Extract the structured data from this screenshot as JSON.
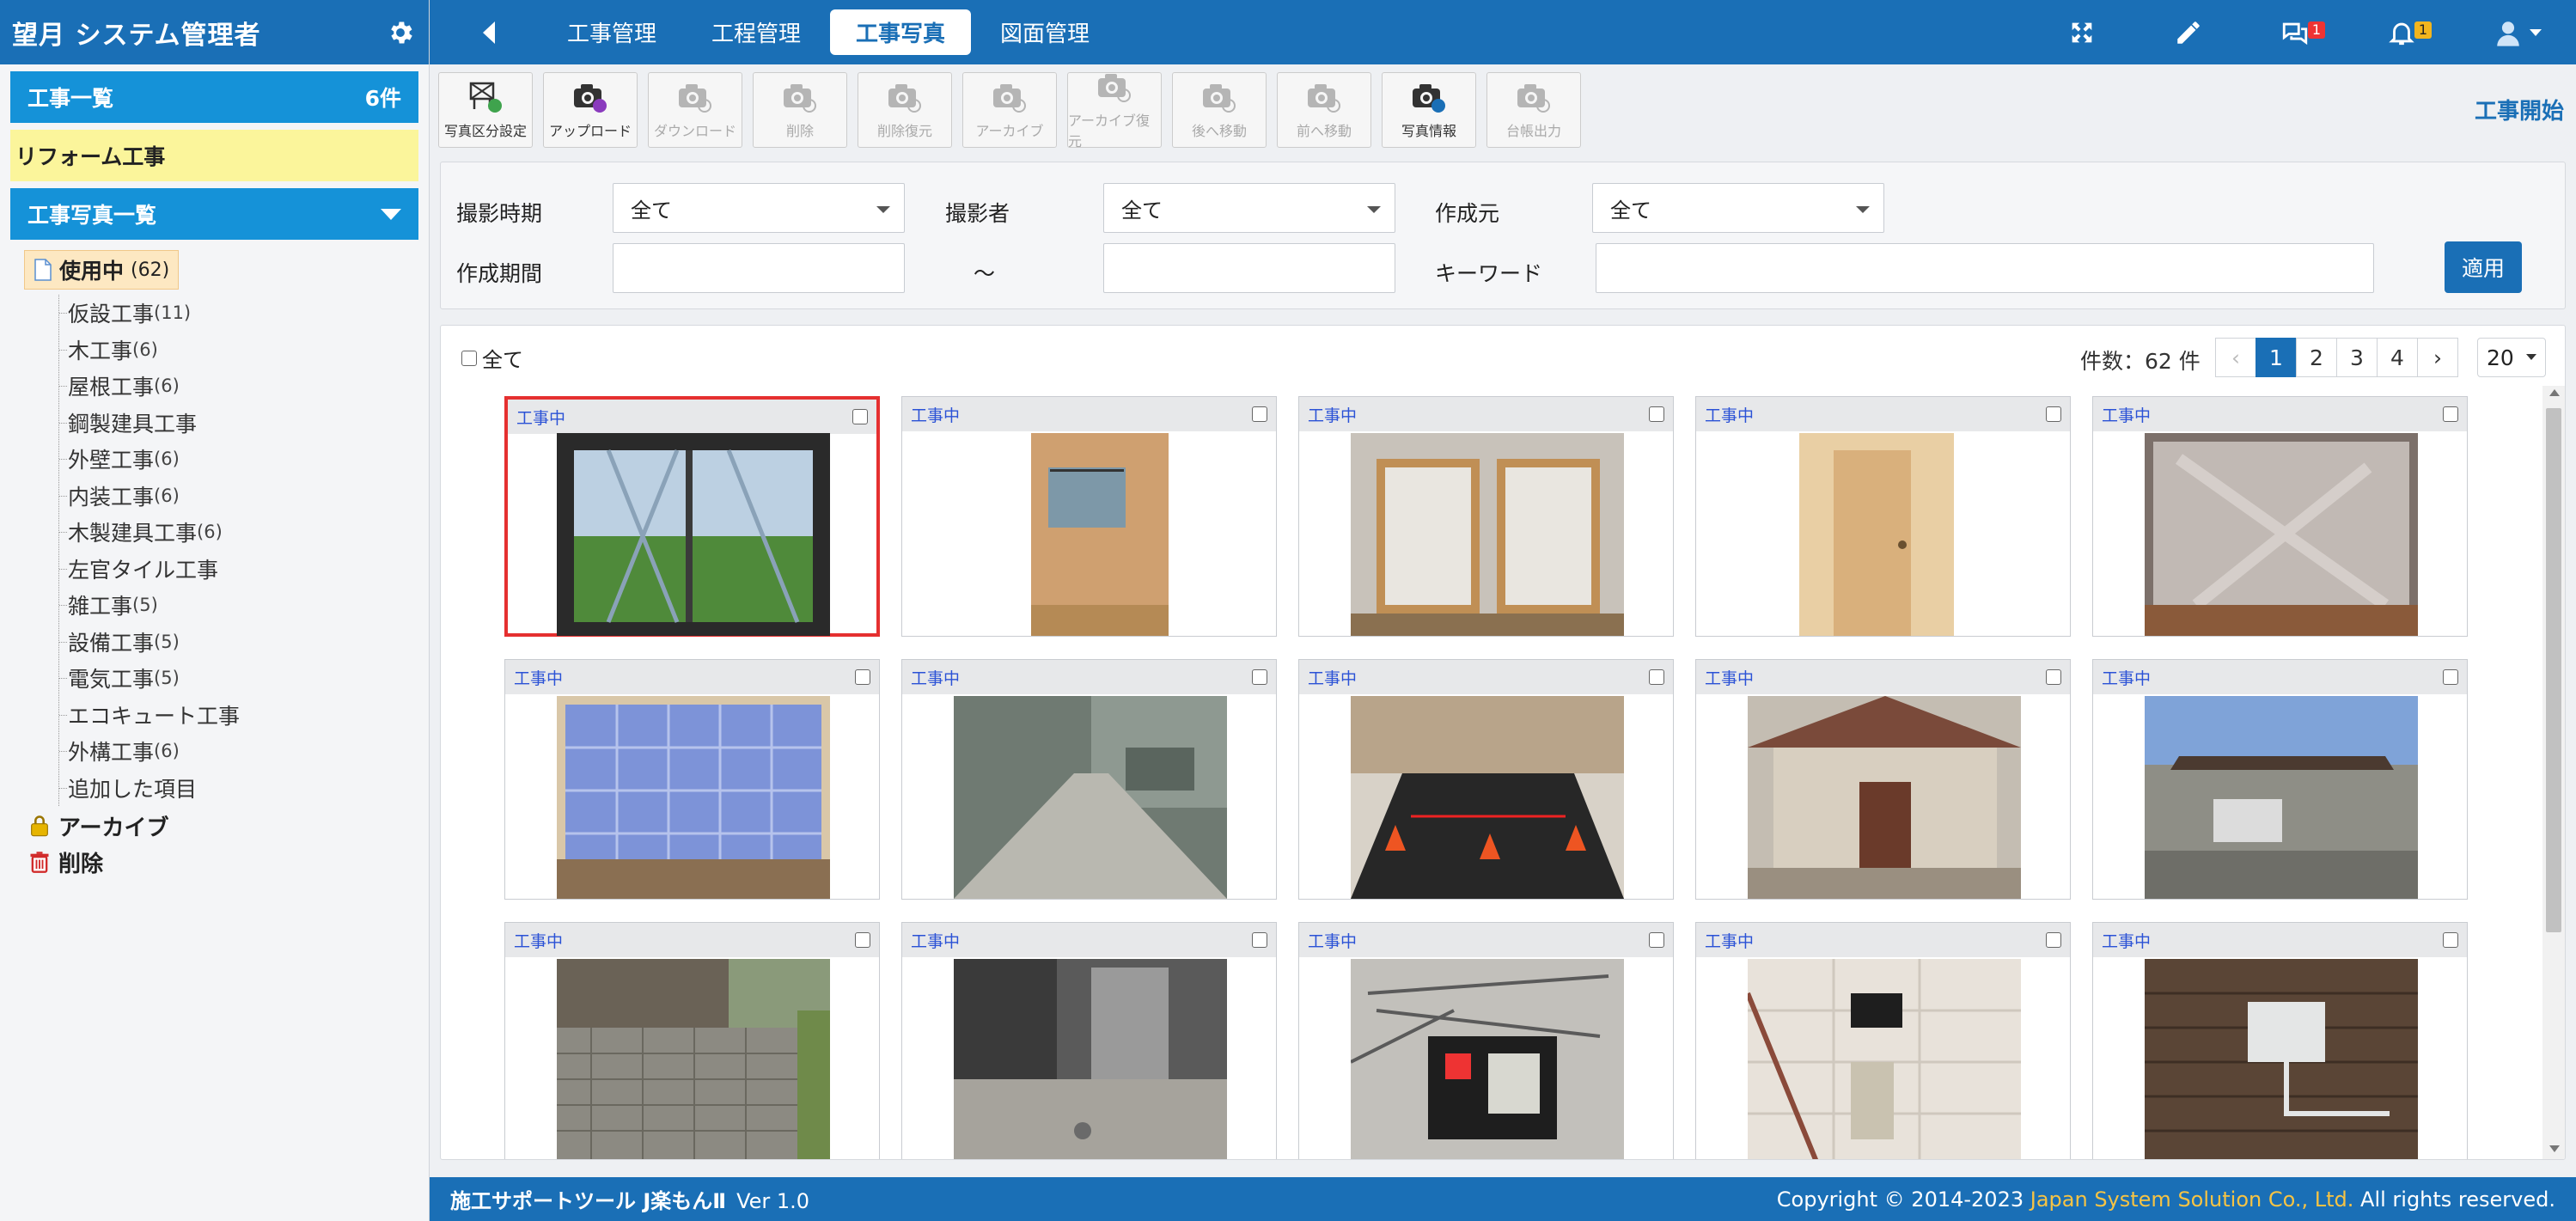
{
  "sidebar": {
    "brand_title": "望月 システム管理者",
    "project_list_label": "工事一覧",
    "project_count": "6件",
    "current_project": "リフォーム工事",
    "photo_list_label": "工事写真一覧",
    "tree_root_label": "使用中",
    "tree_root_count": "(62)",
    "tree_items": [
      {
        "label": "仮設工事",
        "count": "(11)"
      },
      {
        "label": "木工事",
        "count": "(6)"
      },
      {
        "label": "屋根工事",
        "count": "(6)"
      },
      {
        "label": "鋼製建具工事",
        "count": ""
      },
      {
        "label": "外壁工事",
        "count": "(6)"
      },
      {
        "label": "内装工事",
        "count": "(6)"
      },
      {
        "label": "木製建具工事",
        "count": "(6)"
      },
      {
        "label": "左官タイル工事",
        "count": ""
      },
      {
        "label": "雑工事",
        "count": "(5)"
      },
      {
        "label": "設備工事",
        "count": "(5)"
      },
      {
        "label": "電気工事",
        "count": "(5)"
      },
      {
        "label": "エコキュート工事",
        "count": ""
      },
      {
        "label": "外構工事",
        "count": "(6)"
      },
      {
        "label": "追加した項目",
        "count": ""
      }
    ],
    "archive_label": "アーカイブ",
    "delete_label": "削除"
  },
  "topnav": {
    "tabs": [
      "工事管理",
      "工程管理",
      "工事写真",
      "図面管理"
    ],
    "active_tab": "工事写真",
    "chat_badge": "1",
    "bell_badge": "1"
  },
  "toolbar": {
    "buttons": [
      {
        "label": "写真区分設定",
        "enabled": true
      },
      {
        "label": "アップロード",
        "enabled": true
      },
      {
        "label": "ダウンロード",
        "enabled": false
      },
      {
        "label": "削除",
        "enabled": false
      },
      {
        "label": "削除復元",
        "enabled": false
      },
      {
        "label": "アーカイブ",
        "enabled": false
      },
      {
        "label": "アーカイブ復元",
        "enabled": false
      },
      {
        "label": "後へ移動",
        "enabled": false
      },
      {
        "label": "前へ移動",
        "enabled": false
      },
      {
        "label": "写真情報",
        "enabled": true
      },
      {
        "label": "台帳出力",
        "enabled": false
      }
    ],
    "work_start_label": "工事開始"
  },
  "filters": {
    "shoot_time_label": "撮影時期",
    "shoot_time_value": "全て",
    "photographer_label": "撮影者",
    "photographer_value": "全て",
    "creator_label": "作成元",
    "creator_value": "全て",
    "period_label": "作成期間",
    "period_sep": "～",
    "keyword_label": "キーワード",
    "apply_label": "適用"
  },
  "gallery": {
    "select_all_label": "全て",
    "count_text": "件数：62 件",
    "pages": [
      "‹",
      "1",
      "2",
      "3",
      "4",
      "›"
    ],
    "active_page": "1",
    "per_page": "20",
    "status_label": "工事中",
    "photos": [
      {
        "subject": "window-scaffold",
        "selected": true
      },
      {
        "subject": "interior-doorway",
        "selected": false
      },
      {
        "subject": "double-window",
        "selected": false
      },
      {
        "subject": "interior-door",
        "selected": false
      },
      {
        "subject": "plastic-covered-room",
        "selected": false
      },
      {
        "subject": "shoji-panels",
        "selected": false
      },
      {
        "subject": "concrete-walkway",
        "selected": false
      },
      {
        "subject": "parking-cones",
        "selected": false
      },
      {
        "subject": "house-frontage",
        "selected": false
      },
      {
        "subject": "carport",
        "selected": false
      },
      {
        "subject": "block-wall",
        "selected": false
      },
      {
        "subject": "entrance-floor",
        "selected": false
      },
      {
        "subject": "breaker-box",
        "selected": false
      },
      {
        "subject": "wall-outlet",
        "selected": false
      },
      {
        "subject": "meter-box",
        "selected": false
      }
    ]
  },
  "footer": {
    "product": "施工サポートツール J楽もんⅡ",
    "version": "Ver 1.0",
    "copyright_prefix": "Copyright © 2014-2023 ",
    "company": "Japan System Solution Co., Ltd.",
    "copyright_suffix": " All rights reserved."
  },
  "colors": {
    "primary": "#1a6fb6",
    "sidebar_blue": "#1592d8",
    "project_yellow": "#fbf59b",
    "status_text": "#2b52d6",
    "selected_border": "#e53030"
  }
}
